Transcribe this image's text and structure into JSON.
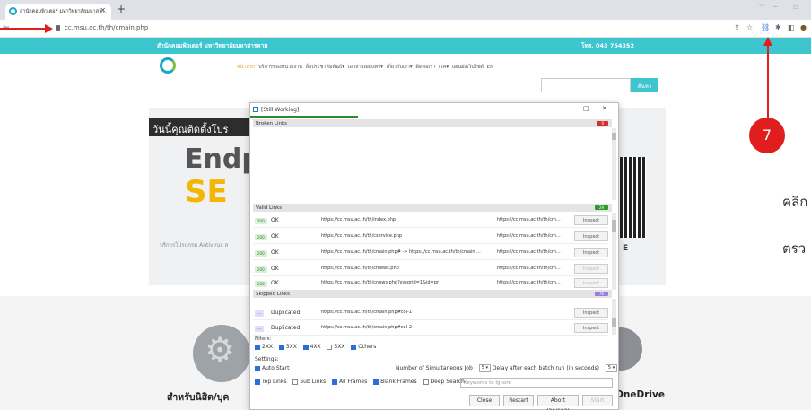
{
  "browser": {
    "tab_title": "สำนักคอมพิวเตอร์ มหาวิทยาลัยมหาสา...",
    "new_tab": "+",
    "url": "cc.msu.ac.th/th/cmain.php"
  },
  "site": {
    "org_name": "สำนักคอมพิวเตอร์ มหาวิทยาลัยมหาสารคาม",
    "phone": "โทร. 043 754352",
    "nav_home": "หน้าแรก",
    "nav_rest": "บริการของหน่วยงาน   สื่อประชาสัมพันธ์▾   เอกสารเผยแพร่▾   เกี่ยวกับเรา▾   ติดต่อเรา   ITA▾   แผนผังเว็บไซต์   EN",
    "search_button": "ค้นหา"
  },
  "banner": {
    "headline": "วันนี้คุณติดตั้งโปร",
    "big_line1": "Endp",
    "big_line2": "SE",
    "footnote": "บริการโปรแกรม Antivirus ส",
    "right_letter": "E"
  },
  "side_text": {
    "line1": "คลิก",
    "line2": "ตรว"
  },
  "bottom": {
    "left_label": "สำหรับนิสิต/บุค",
    "right_label": "OneDrive"
  },
  "annotation": {
    "step_number": "7",
    "accent_color": "#e01e1e"
  },
  "popup": {
    "title": "[Still Working]",
    "broken_section": "Broken Links",
    "broken_count": "0",
    "valid_section": "Valid Links",
    "valid_count": "29",
    "skipped_section": "Skipped Links",
    "skipped_count": "76",
    "valid_rows": [
      {
        "code": "200",
        "status": "OK",
        "link": "https://cc.msu.ac.th/th/index.php",
        "src": "https://cc.msu.ac.th/th/cm...",
        "action": "Inspect"
      },
      {
        "code": "200",
        "status": "OK",
        "link": "https://cc.msu.ac.th/th/cservice.php",
        "src": "https://cc.msu.ac.th/th/cm...",
        "action": "Inspect"
      },
      {
        "code": "200",
        "status": "OK",
        "link": "https://cc.msu.ac.th/th/cmain.php# -> https://cc.msu.ac.th/th/cmain ...",
        "src": "https://cc.msu.ac.th/th/cm...",
        "action": "Inspect"
      },
      {
        "code": "200",
        "status": "OK",
        "link": "https://cc.msu.ac.th/th/cfnews.php",
        "src": "https://cc.msu.ac.th/th/cm...",
        "action": "Inspect"
      },
      {
        "code": "200",
        "status": "OK",
        "link": "https://cc.msu.ac.th/th/cnews.php?sysgrid=1&id=pr",
        "src": "https://cc.msu.ac.th/th/cm...",
        "action": "Inspect"
      }
    ],
    "skipped_rows": [
      {
        "code": "---",
        "status": "Duplicated",
        "link": "https://cc.msu.ac.th/th/cmain.php#col-1",
        "action": "Inspect"
      },
      {
        "code": "---",
        "status": "Duplicated",
        "link": "https://cc.msu.ac.th/th/cmain.php#col-2",
        "action": "Inspect"
      }
    ],
    "filters_label": "Filters:",
    "filters": [
      "2XX",
      "3XX",
      "4XX",
      "5XX",
      "Others"
    ],
    "settings_label": "Settings:",
    "auto_start": "Auto Start",
    "simultaneous_label": "Number of Simultaneous Job",
    "simultaneous_value": "5",
    "delay_label": "Delay after each batch run (in seconds)",
    "delay_value": "5",
    "options": [
      "Top Links",
      "Sub Links",
      "All Frames",
      "Blank Frames",
      "Deep Search"
    ],
    "keywords_placeholder": "Keywords to Ignore",
    "btn_close": "Close",
    "btn_restart": "Restart",
    "btn_abort": "Abort (36/122)",
    "btn_start": "Start"
  }
}
